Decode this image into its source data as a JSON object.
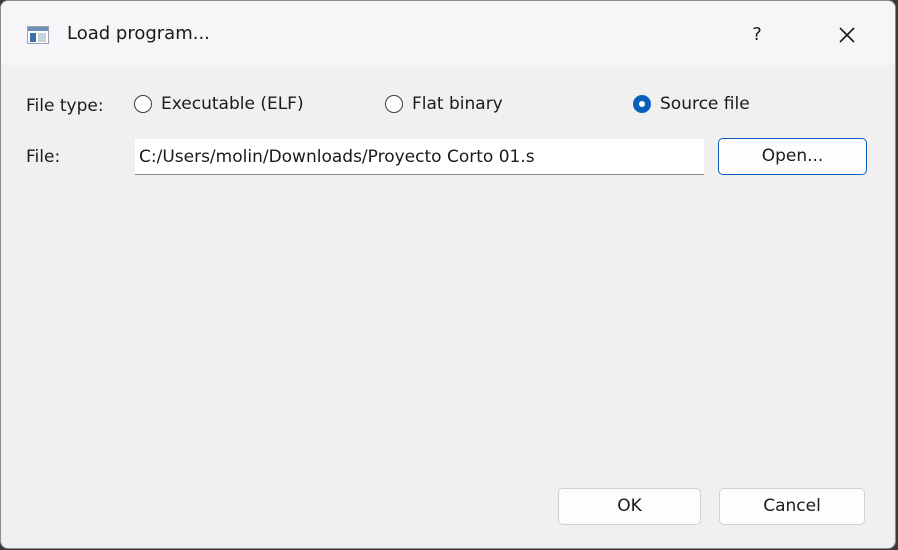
{
  "window": {
    "title": "Load program...",
    "help_label": "?",
    "close_icon": "close-icon",
    "app_icon": "window-app-icon"
  },
  "file_type": {
    "label": "File type:",
    "options": [
      {
        "label": "Executable (ELF)",
        "checked": false
      },
      {
        "label": "Flat binary",
        "checked": false
      },
      {
        "label": "Source file",
        "checked": true
      }
    ]
  },
  "file": {
    "label": "File:",
    "value": "C:/Users/molin/Downloads/Proyecto Corto 01.s",
    "open_label": "Open..."
  },
  "footer": {
    "ok_label": "OK",
    "cancel_label": "Cancel"
  },
  "colors": {
    "accent": "#0a5ebd",
    "background": "#f0f0f0",
    "titlebar": "#f6f6f8"
  }
}
